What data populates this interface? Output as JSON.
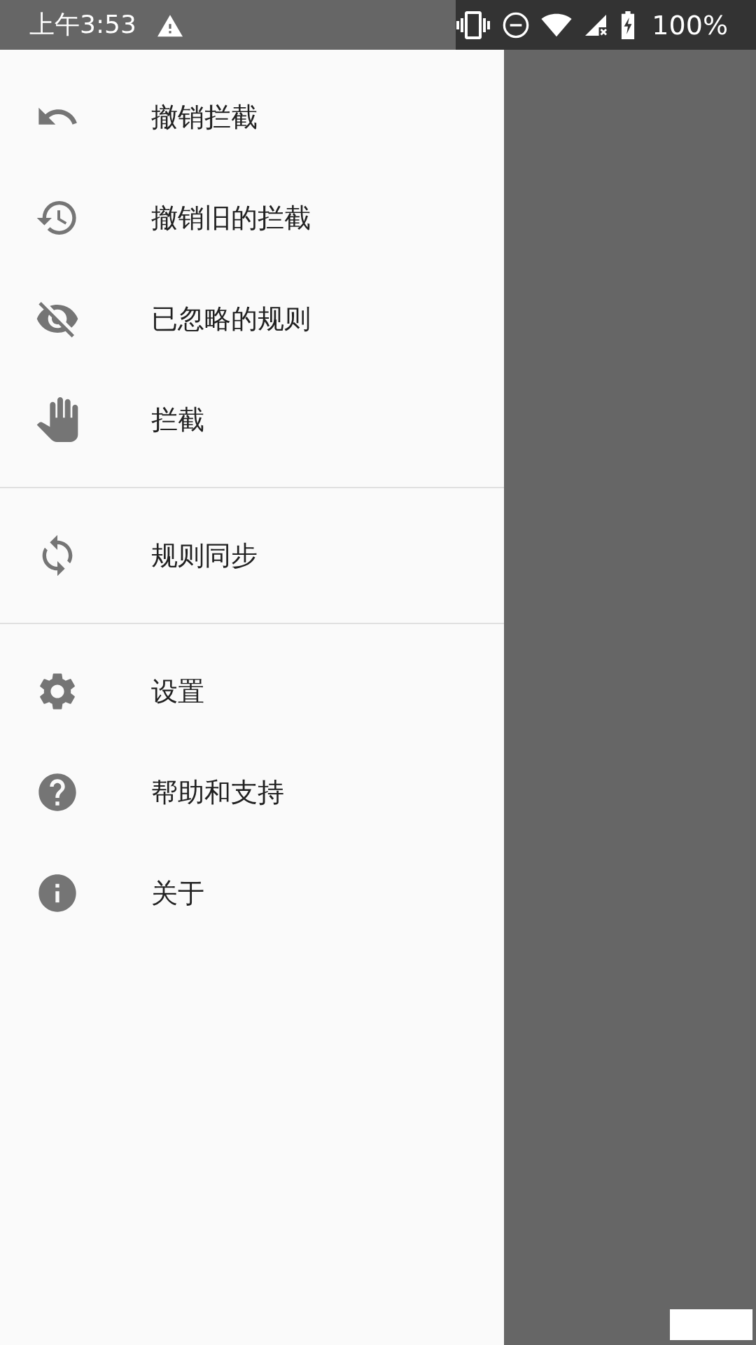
{
  "status_bar": {
    "time": "上午3:53",
    "battery": "100%"
  },
  "drawer": {
    "groups": [
      {
        "items": [
          {
            "kind": "undo",
            "label": "撤销拦截"
          },
          {
            "kind": "history",
            "label": "撤销旧的拦截"
          },
          {
            "kind": "hidden",
            "label": "已忽略的规则"
          },
          {
            "kind": "hand",
            "label": "拦截"
          }
        ]
      },
      {
        "items": [
          {
            "kind": "sync",
            "label": "规则同步"
          }
        ]
      },
      {
        "items": [
          {
            "kind": "settings",
            "label": "设置"
          },
          {
            "kind": "help",
            "label": "帮助和支持"
          },
          {
            "kind": "info",
            "label": "关于"
          }
        ]
      }
    ]
  }
}
